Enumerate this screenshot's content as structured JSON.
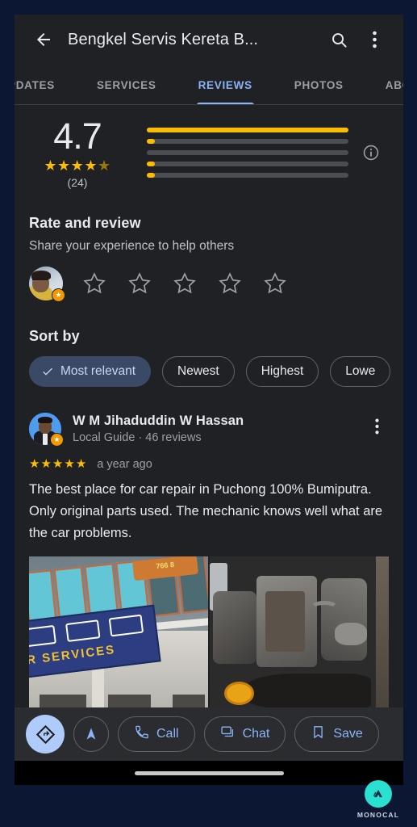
{
  "theme": {
    "page_background": "#0b1733",
    "screen_background": "#202124",
    "accent_blue": "#8ab4f8",
    "star_gold": "#fbbc04",
    "selected_chip_bg": "#3a4a66",
    "badge_orange": "#f29900",
    "watermark_teal": "#2ae0d0"
  },
  "appbar": {
    "back_icon": "back-arrow-icon",
    "title": "Bengkel Servis Kereta B...",
    "search_icon": "search-icon",
    "overflow_icon": "more-vertical-icon"
  },
  "tabs": [
    {
      "label": "PDATES",
      "active": false
    },
    {
      "label": "SERVICES",
      "active": false
    },
    {
      "label": "REVIEWS",
      "active": true
    },
    {
      "label": "PHOTOS",
      "active": false
    },
    {
      "label": "ABOUT",
      "active": false
    }
  ],
  "rating_summary": {
    "score": "4.7",
    "stars_filled": 4,
    "stars_half": 1,
    "review_count": "(24)",
    "info_icon": "info-circle-icon",
    "bars": [
      {
        "stars": 5,
        "percent": 100
      },
      {
        "stars": 4,
        "percent": 4
      },
      {
        "stars": 3,
        "percent": 0
      },
      {
        "stars": 2,
        "percent": 4
      },
      {
        "stars": 1,
        "percent": 4
      }
    ]
  },
  "rate_and_review": {
    "title": "Rate and review",
    "subtitle": "Share your experience to help others",
    "avatar_name": "current-user-avatar",
    "local_guide_badge": "local-guide-badge",
    "star_count": 5,
    "stars_selected": 0
  },
  "sort": {
    "title": "Sort by",
    "chips": [
      {
        "label": "Most relevant",
        "selected": true
      },
      {
        "label": "Newest",
        "selected": false
      },
      {
        "label": "Highest",
        "selected": false
      },
      {
        "label": "Lowe",
        "selected": false
      }
    ]
  },
  "review": {
    "author": "W M Jihaduddin W Hassan",
    "meta": "Local Guide · 46 reviews",
    "rating": 5,
    "time": "a year ago",
    "text": "The best place for car repair in Puchong 100% Bumiputra. Only original parts used. The mechanic knows well what are the car problems.",
    "overflow_icon": "more-vertical-icon",
    "photos": [
      {
        "name": "shop-front-photo",
        "caption": "AR SERVICES",
        "sign_number": "766 8"
      },
      {
        "name": "engine-bay-photo",
        "caption": ""
      }
    ]
  },
  "action_bar": {
    "directions_icon": "directions-icon",
    "navigate_icon": "navigation-arrow-icon",
    "buttons": [
      {
        "label": "Call",
        "icon": "phone-icon"
      },
      {
        "label": "Chat",
        "icon": "chat-bubble-icon"
      },
      {
        "label": "Save",
        "icon": "bookmark-icon"
      }
    ]
  },
  "watermark": {
    "text": "MONOCAL",
    "logo_icon": "monocal-logo-icon"
  }
}
